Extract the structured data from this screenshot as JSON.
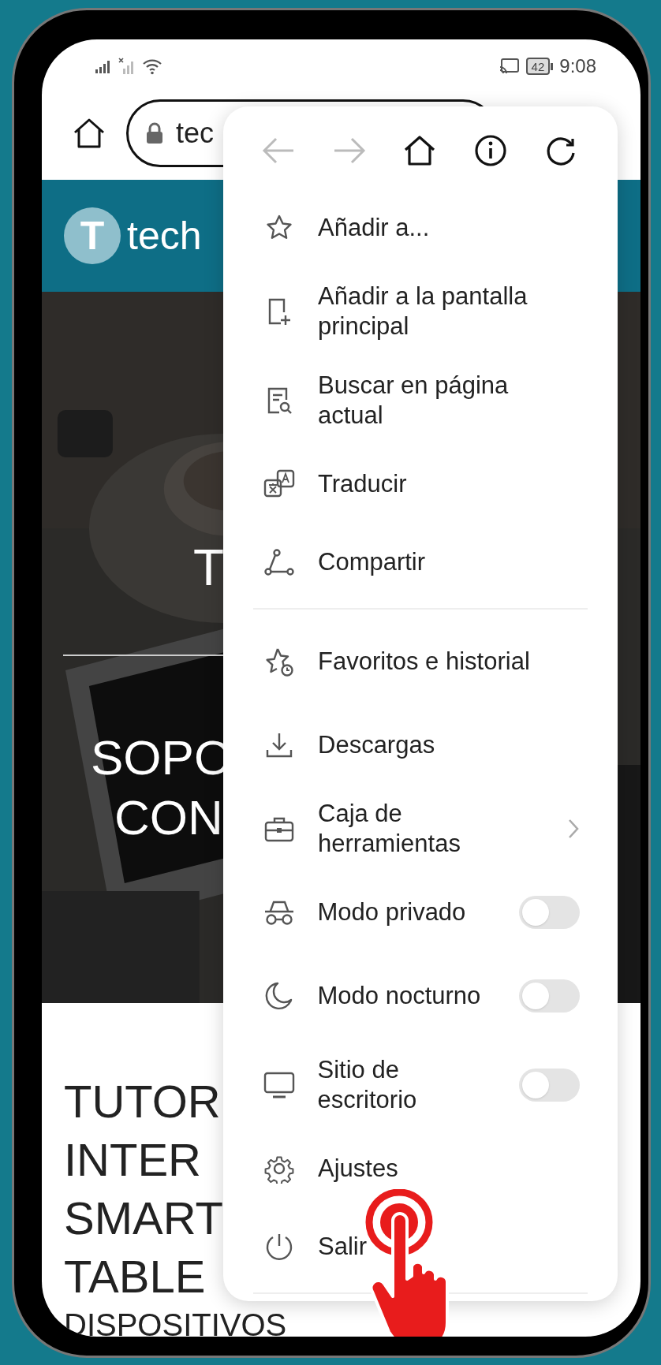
{
  "status_bar": {
    "battery": "42",
    "time": "9:08"
  },
  "browser": {
    "url": "tec"
  },
  "site": {
    "logo_letter": "T",
    "logo_text": "tech",
    "hero_lines": [
      "T",
      "SOPO",
      "CON"
    ],
    "headline_lines": [
      "TUTOR",
      "INTER",
      "SMART",
      "TABLE"
    ],
    "subline": "DISPOSITIVOS"
  },
  "menu": {
    "nav_buttons": [
      {
        "kind": "back",
        "disabled": true
      },
      {
        "kind": "forward",
        "disabled": true
      },
      {
        "kind": "home",
        "disabled": false
      },
      {
        "kind": "info",
        "disabled": false
      },
      {
        "kind": "reload",
        "disabled": false
      }
    ],
    "items": [
      {
        "kind": "action",
        "label": "Añadir a..."
      },
      {
        "kind": "action",
        "label": "Añadir a la pantalla principal"
      },
      {
        "kind": "action",
        "label": "Buscar en página actual"
      },
      {
        "kind": "action",
        "label": "Traducir"
      },
      {
        "kind": "action",
        "label": "Compartir"
      },
      {
        "kind": "divider"
      },
      {
        "kind": "action",
        "label": "Favoritos e historial"
      },
      {
        "kind": "action",
        "label": "Descargas"
      },
      {
        "kind": "submenu",
        "label": "Caja de herramientas"
      },
      {
        "kind": "toggle",
        "label": "Modo privado",
        "on": false
      },
      {
        "kind": "toggle",
        "label": "Modo nocturno",
        "on": false
      },
      {
        "kind": "toggle",
        "label": "Sitio de escritorio",
        "on": false
      },
      {
        "kind": "action",
        "label": "Ajustes"
      },
      {
        "kind": "action",
        "label": "Salir"
      },
      {
        "kind": "divider"
      }
    ]
  }
}
